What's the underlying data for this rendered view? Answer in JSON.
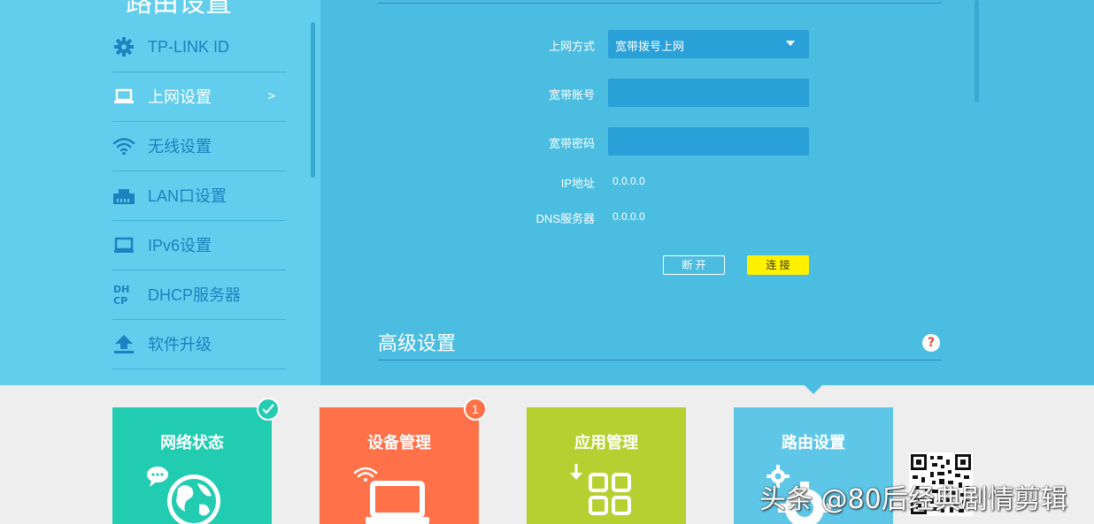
{
  "sidebar": {
    "title": "路由设置",
    "items": [
      {
        "label": "TP-LINK ID",
        "icon": "gear-icon"
      },
      {
        "label": "上网设置",
        "icon": "laptop-icon",
        "arrow": ">"
      },
      {
        "label": "无线设置",
        "icon": "wifi-icon"
      },
      {
        "label": "LAN口设置",
        "icon": "lan-port-icon"
      },
      {
        "label": "IPv6设置",
        "icon": "monitor-icon"
      },
      {
        "label": "DHCP服务器",
        "icon": "dhcp-icon"
      },
      {
        "label": "软件升级",
        "icon": "upload-icon"
      }
    ]
  },
  "form": {
    "connection_type_label": "上网方式",
    "connection_type_value": "宽带拨号上网",
    "account_label": "宽带账号",
    "account_value": "",
    "password_label": "宽带密码",
    "password_value": "",
    "ip_label": "IP地址",
    "ip_value": "0.0.0.0",
    "dns_label": "DNS服务器",
    "dns_value": "0.0.0.0",
    "disconnect_label": "断 开",
    "connect_label": "连 接"
  },
  "advanced": {
    "title": "高级设置",
    "help_label": "?"
  },
  "tiles": [
    {
      "label": "网络状态",
      "badge": "✓"
    },
    {
      "label": "设备管理",
      "badge": "1"
    },
    {
      "label": "应用管理"
    },
    {
      "label": "路由设置"
    }
  ],
  "watermark": "头条 @80后经典剧情剪辑",
  "colors": {
    "sidebar_bg": "#62cdec",
    "main_bg": "#4bbde1",
    "input_bg": "#2aa0d8",
    "connect_button": "#fff100",
    "tile_network": "#22ccb1",
    "tile_devices": "#ff7148",
    "tile_apps": "#b6d032",
    "tile_router": "#5ec7e8"
  }
}
